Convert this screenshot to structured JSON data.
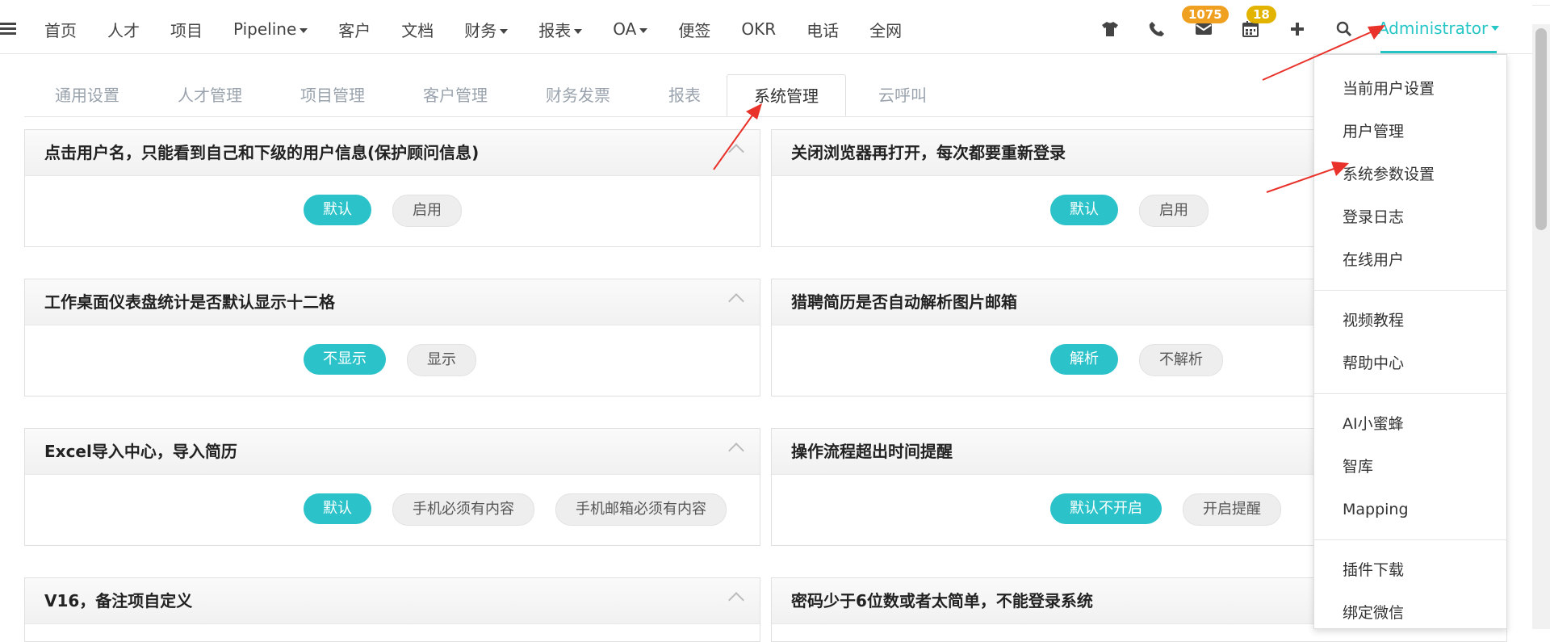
{
  "nav": {
    "items": [
      {
        "label": "首页",
        "caret": false
      },
      {
        "label": "人才",
        "caret": false
      },
      {
        "label": "项目",
        "caret": false
      },
      {
        "label": "Pipeline",
        "caret": true
      },
      {
        "label": "客户",
        "caret": false
      },
      {
        "label": "文档",
        "caret": false
      },
      {
        "label": "财务",
        "caret": true
      },
      {
        "label": "报表",
        "caret": true
      },
      {
        "label": "OA",
        "caret": true
      },
      {
        "label": "便签",
        "caret": false
      },
      {
        "label": "OKR",
        "caret": false
      },
      {
        "label": "电话",
        "caret": false
      },
      {
        "label": "全网",
        "caret": false
      }
    ]
  },
  "tools": {
    "mail_badge": "1075",
    "calendar_badge": "18",
    "user_label": "Administrator",
    "accent_color": "#26c6c6"
  },
  "tabs": [
    {
      "label": "通用设置",
      "active": false
    },
    {
      "label": "人才管理",
      "active": false
    },
    {
      "label": "项目管理",
      "active": false
    },
    {
      "label": "客户管理",
      "active": false
    },
    {
      "label": "财务发票",
      "active": false
    },
    {
      "label": "报表",
      "active": false
    },
    {
      "label": "系统管理",
      "active": true
    },
    {
      "label": "云呼叫",
      "active": false
    }
  ],
  "cards_left": [
    {
      "title": "点击用户名，只能看到自己和下级的用户信息(保护顾问信息)",
      "options": [
        {
          "label": "默认",
          "on": true
        },
        {
          "label": "启用",
          "on": false
        }
      ]
    },
    {
      "title": "工作桌面仪表盘统计是否默认显示十二格",
      "options": [
        {
          "label": "不显示",
          "on": true
        },
        {
          "label": "显示",
          "on": false
        }
      ]
    },
    {
      "title": "Excel导入中心，导入简历",
      "options": [
        {
          "label": "默认",
          "on": true
        },
        {
          "label": "手机必须有内容",
          "on": false
        },
        {
          "label": "手机邮箱必须有内容",
          "on": false
        }
      ]
    },
    {
      "title": "V16，备注项自定义",
      "options": []
    }
  ],
  "cards_right": [
    {
      "title": "关闭浏览器再打开，每次都要重新登录",
      "options": [
        {
          "label": "默认",
          "on": true
        },
        {
          "label": "启用",
          "on": false
        }
      ]
    },
    {
      "title": "猎聘简历是否自动解析图片邮箱",
      "options": [
        {
          "label": "解析",
          "on": true
        },
        {
          "label": "不解析",
          "on": false
        }
      ]
    },
    {
      "title": "操作流程超出时间提醒",
      "options": [
        {
          "label": "默认不开启",
          "on": true
        },
        {
          "label": "开启提醒",
          "on": false
        }
      ]
    },
    {
      "title": "密码少于6位数或者太简单，不能登录系统",
      "options": []
    }
  ],
  "dropdown": {
    "groups": [
      [
        "当前用户设置",
        "用户管理",
        "系统参数设置",
        "登录日志",
        "在线用户"
      ],
      [
        "视频教程",
        "帮助中心"
      ],
      [
        "AI小蜜蜂",
        "智库",
        "Mapping"
      ],
      [
        "插件下载",
        "绑定微信"
      ]
    ]
  },
  "colors": {
    "toggle_on": "#2bc3c9",
    "badge_orange": "#f0a020",
    "badge_yellow": "#e2b400",
    "arrow_red": "#e8322a"
  }
}
